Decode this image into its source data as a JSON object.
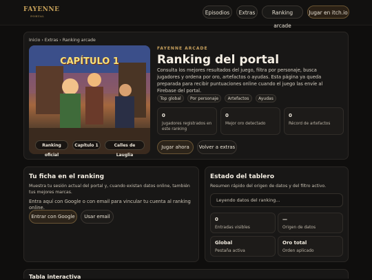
{
  "header": {
    "logo_text": "FAYENNE",
    "logo_sub": "PORTAL",
    "nav": [
      "Episodios",
      "Extras",
      "Ranking arcade",
      "Jugar en itch.io"
    ]
  },
  "hero": {
    "breadcrumb": "Inicio › Extras › Ranking arcade",
    "image_title": "CAPÍTULO 1",
    "image_chips": [
      "Ranking oficial",
      "Capítulo 1",
      "Calles de Lauglia"
    ],
    "eyebrow": "FAYENNE ARCADE",
    "title": "Ranking del portal",
    "description": "Consulta los mejores resultados del juego, filtra por personaje, busca jugadores y ordena por oro, artefactos o ayudas. Esta página ya queda preparada para recibir puntuaciones online cuando el juego las envíe al Firebase del portal.",
    "pills": [
      "Top global",
      "Por personaje",
      "Artefactos",
      "Ayudas"
    ],
    "stats": [
      {
        "value": "0",
        "label": "Jugadores registrados en este ranking"
      },
      {
        "value": "0",
        "label": "Mejor oro detectado"
      },
      {
        "value": "0",
        "label": "Récord de artefactos"
      }
    ],
    "play_button": "Jugar ahora",
    "back_button": "Volver a extras"
  },
  "profile": {
    "title": "Tu ficha en el ranking",
    "text": "Muestra tu sesión actual del portal y, cuando existan datos online, también tus mejores marcas.",
    "text2": "Entra aquí con Google o con email para vincular tu cuenta al ranking online.",
    "google_button": "Entrar con Google",
    "email_button": "Usar email"
  },
  "board": {
    "title": "Estado del tablero",
    "text": "Resumen rápido del origen de datos y del filtro activo.",
    "loading": "Leyendo datos del ranking...",
    "cards": [
      {
        "value": "0",
        "label": "Entradas visibles"
      },
      {
        "value": "—",
        "label": "Origen de datos"
      },
      {
        "value": "Global",
        "label": "Pestaña activa"
      },
      {
        "value": "Oro total",
        "label": "Orden aplicado"
      }
    ]
  },
  "table": {
    "title": "Tabla interactiva"
  }
}
